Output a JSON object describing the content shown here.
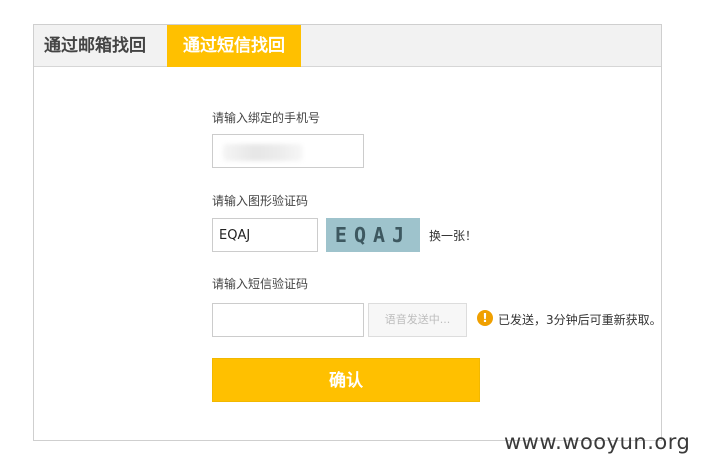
{
  "tabs": [
    {
      "label": "通过邮箱找回",
      "active": false
    },
    {
      "label": "通过短信找回",
      "active": true
    }
  ],
  "form": {
    "phone_label": "请输入绑定的手机号",
    "phone_value": "",
    "captcha_label": "请输入图形验证码",
    "captcha_value": "EQAJ",
    "captcha_image_text": "EQAJ",
    "captcha_refresh": "换一张！",
    "sms_label": "请输入短信验证码",
    "sms_value": "",
    "voice_button": "语音发送中...",
    "notice": "已发送，3分钟后可重新获取。",
    "confirm_button": "确认"
  },
  "watermark": "www.wooyun.org",
  "colors": {
    "accent": "#ffc000",
    "captcha_bg": "#9ec3cc",
    "warning": "#f0a000"
  }
}
